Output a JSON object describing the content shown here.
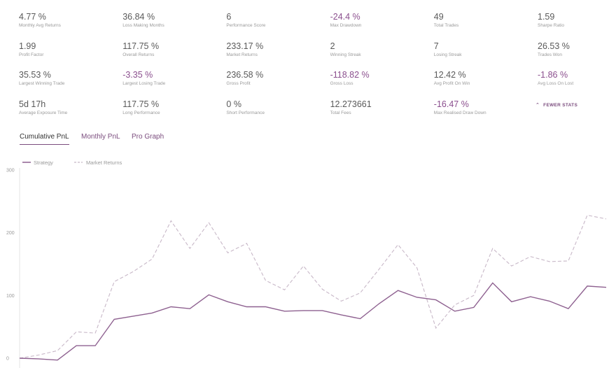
{
  "colors": {
    "positive": "#5a5a5a",
    "negative": "#8b4f8e",
    "accent": "#7b4d7e",
    "strategy_line": "#8e6190",
    "market_line": "#c8b8c8",
    "label": "#9a9a9a"
  },
  "stats": [
    {
      "value": "4.77 %",
      "label": "Monthly Avg Returns",
      "tone": "positive"
    },
    {
      "value": "36.84 %",
      "label": "Loss Making Months",
      "tone": "positive"
    },
    {
      "value": "6",
      "label": "Performance Score",
      "tone": "positive"
    },
    {
      "value": "-24.4 %",
      "label": "Max Drawdown",
      "tone": "negative"
    },
    {
      "value": "49",
      "label": "Total Trades",
      "tone": "positive"
    },
    {
      "value": "1.59",
      "label": "Sharpe Ratio",
      "tone": "positive"
    },
    {
      "value": "1.99",
      "label": "Profit Factor",
      "tone": "positive"
    },
    {
      "value": "117.75 %",
      "label": "Overall Returns",
      "tone": "positive"
    },
    {
      "value": "233.17 %",
      "label": "Market Returns",
      "tone": "positive"
    },
    {
      "value": "2",
      "label": "Winning Streak",
      "tone": "positive"
    },
    {
      "value": "7",
      "label": "Losing Streak",
      "tone": "positive"
    },
    {
      "value": "26.53 %",
      "label": "Trades Won",
      "tone": "positive"
    },
    {
      "value": "35.53 %",
      "label": "Largest Winning Trade",
      "tone": "positive"
    },
    {
      "value": "-3.35 %",
      "label": "Largest Losing Trade",
      "tone": "negative"
    },
    {
      "value": "236.58 %",
      "label": "Gross Profit",
      "tone": "positive"
    },
    {
      "value": "-118.82 %",
      "label": "Gross Loss",
      "tone": "negative"
    },
    {
      "value": "12.42 %",
      "label": "Avg Profit On Win",
      "tone": "positive"
    },
    {
      "value": "-1.86 %",
      "label": "Avg Loss On Lost",
      "tone": "negative"
    },
    {
      "value": "5d 17h",
      "label": "Average Exposure Time",
      "tone": "positive"
    },
    {
      "value": "117.75 %",
      "label": "Long Performance",
      "tone": "positive"
    },
    {
      "value": "0 %",
      "label": "Short Performance",
      "tone": "positive"
    },
    {
      "value": "12.273661",
      "label": "Total Fees",
      "tone": "positive"
    },
    {
      "value": "-16.47 %",
      "label": "Max Realised Draw Down",
      "tone": "negative"
    }
  ],
  "fewer_stats": {
    "label": "FEWER STATS",
    "icon": "chevron-up-icon"
  },
  "tabs": [
    {
      "label": "Cumulative PnL",
      "active": true
    },
    {
      "label": "Monthly PnL",
      "active": false
    },
    {
      "label": "Pro Graph",
      "active": false
    }
  ],
  "chart_data": {
    "type": "line",
    "legend": [
      "Strategy",
      "Market Returns"
    ],
    "legend_position": "top-left",
    "y_ticks": [
      0,
      100,
      200,
      300
    ],
    "ylim": [
      0,
      300
    ],
    "grid": false,
    "series": [
      {
        "name": "Strategy",
        "style": "solid",
        "values": [
          0,
          -1,
          -3,
          20,
          20,
          62,
          67,
          72,
          82,
          79,
          101,
          90,
          82,
          82,
          75,
          76,
          76,
          69,
          63,
          87,
          108,
          97,
          93,
          75,
          81,
          120,
          90,
          98,
          91,
          79,
          115,
          113
        ]
      },
      {
        "name": "Market Returns",
        "style": "dashed",
        "values": [
          0,
          5,
          12,
          42,
          40,
          122,
          138,
          158,
          219,
          175,
          216,
          168,
          183,
          124,
          109,
          147,
          110,
          91,
          104,
          142,
          181,
          144,
          48,
          85,
          100,
          175,
          147,
          162,
          154,
          155,
          228,
          222
        ]
      }
    ]
  }
}
